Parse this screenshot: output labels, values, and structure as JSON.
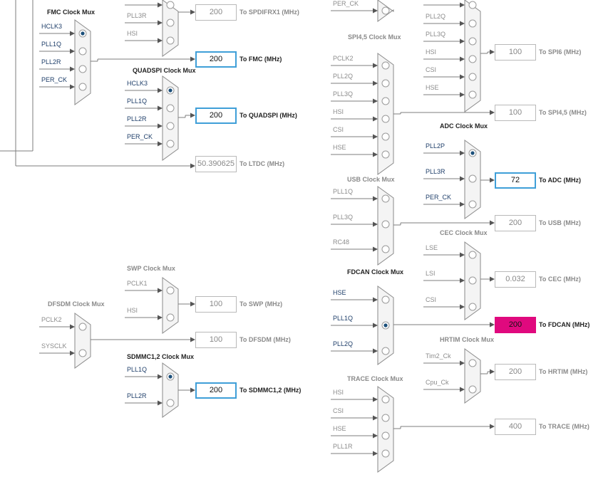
{
  "muxes": [
    {
      "name": "fmc-clock-mux",
      "title": "FMC Clock Mux",
      "active": true,
      "inputs": [
        "HCLK3",
        "PLL1Q",
        "PLL2R",
        "PER_CK"
      ],
      "selected": 0
    },
    {
      "name": "quadspi-clock-mux",
      "title": "QUADSPI Clock Mux",
      "active": true,
      "inputs": [
        "HCLK3",
        "PLL1Q",
        "PLL2R",
        "PER_CK"
      ],
      "selected": 0
    },
    {
      "name": "spdifrx1-clock-mux",
      "title": "",
      "active": false,
      "inputs": [
        "PLL3R",
        "HSI"
      ],
      "selected": null
    },
    {
      "name": "swp-clock-mux",
      "title": "SWP Clock Mux",
      "active": false,
      "inputs": [
        "PCLK1",
        "HSI"
      ],
      "selected": null
    },
    {
      "name": "dfsdm-clock-mux",
      "title": "DFSDM Clock Mux",
      "active": false,
      "inputs": [
        "PCLK2",
        "SYSCLK"
      ],
      "selected": null
    },
    {
      "name": "sdmmc12-clock-mux",
      "title": "SDMMC1,2 Clock Mux",
      "active": true,
      "inputs": [
        "PLL1Q",
        "PLL2R"
      ],
      "selected": 0
    },
    {
      "name": "sai23-clock-mux",
      "title": "",
      "active": false,
      "inputs": [
        "PER_CK"
      ],
      "selected": null
    },
    {
      "name": "spi45-clock-mux",
      "title": "SPI4,5 Clock Mux",
      "active": false,
      "inputs": [
        "PCLK2",
        "PLL2Q",
        "PLL3Q",
        "HSI",
        "CSI",
        "HSE"
      ],
      "selected": null
    },
    {
      "name": "usb-clock-mux",
      "title": "USB Clock Mux",
      "active": false,
      "inputs": [
        "PLL1Q",
        "PLL3Q",
        "RC48"
      ],
      "selected": null
    },
    {
      "name": "fdcan-clock-mux",
      "title": "FDCAN Clock Mux",
      "active": true,
      "inputs": [
        "HSE",
        "PLL1Q",
        "PLL2Q"
      ],
      "selected": 1
    },
    {
      "name": "trace-clock-mux",
      "title": "TRACE Clock Mux",
      "active": false,
      "inputs": [
        "HSI",
        "CSI",
        "HSE",
        "PLL1R"
      ],
      "selected": null
    },
    {
      "name": "spi6-clock-mux",
      "title": "",
      "active": false,
      "inputs": [
        "PLL2Q",
        "PLL3Q",
        "HSI",
        "CSI",
        "HSE"
      ],
      "selected": null
    },
    {
      "name": "adc-clock-mux",
      "title": "ADC Clock Mux",
      "active": true,
      "inputs": [
        "PLL2P",
        "PLL3R",
        "PER_CK"
      ],
      "selected": 0
    },
    {
      "name": "cec-clock-mux",
      "title": "CEC Clock Mux",
      "active": false,
      "inputs": [
        "LSE",
        "LSI",
        "CSI"
      ],
      "selected": null
    },
    {
      "name": "hrtim-clock-mux",
      "title": "HRTIM Clock Mux",
      "active": false,
      "inputs": [
        "Tim2_Ck",
        "Cpu_Ck"
      ],
      "selected": null
    }
  ],
  "outputs": [
    {
      "name": "spdifrx1-output",
      "value": "200",
      "label": "To SPDIFRX1 (MHz)",
      "style": "inactive"
    },
    {
      "name": "fmc-output",
      "value": "200",
      "label": "To FMC (MHz)",
      "style": "active"
    },
    {
      "name": "quadspi-output",
      "value": "200",
      "label": "To QUADSPI (MHz)",
      "style": "active"
    },
    {
      "name": "ltdc-output",
      "value": "50.390625",
      "label": "To LTDC (MHz)",
      "style": "inactive"
    },
    {
      "name": "swp-output",
      "value": "100",
      "label": "To SWP (MHz)",
      "style": "inactive"
    },
    {
      "name": "dfsdm-output",
      "value": "100",
      "label": "To DFSDM (MHz)",
      "style": "inactive"
    },
    {
      "name": "sdmmc12-output",
      "value": "200",
      "label": "To SDMMC1,2 (MHz)",
      "style": "active"
    },
    {
      "name": "spi6-output",
      "value": "100",
      "label": "To SPI6 (MHz)",
      "style": "inactive"
    },
    {
      "name": "spi45-output",
      "value": "100",
      "label": "To SPI4,5 (MHz)",
      "style": "inactive"
    },
    {
      "name": "adc-output",
      "value": "72",
      "label": "To ADC (MHz)",
      "style": "active"
    },
    {
      "name": "usb-output",
      "value": "200",
      "label": "To USB (MHz)",
      "style": "inactive"
    },
    {
      "name": "cec-output",
      "value": "0.032",
      "label": "To CEC (MHz)",
      "style": "inactive"
    },
    {
      "name": "fdcan-output",
      "value": "200",
      "label": "To FDCAN (MHz)",
      "style": "magenta"
    },
    {
      "name": "hrtim-output",
      "value": "200",
      "label": "To HRTIM (MHz)",
      "style": "inactive"
    },
    {
      "name": "trace-output",
      "value": "400",
      "label": "To TRACE (MHz)",
      "style": "inactive"
    }
  ],
  "colors": {
    "accent_border": "#3f9fd8",
    "error_fill": "#e0097e",
    "selected_dot": "#1b4f7a"
  }
}
